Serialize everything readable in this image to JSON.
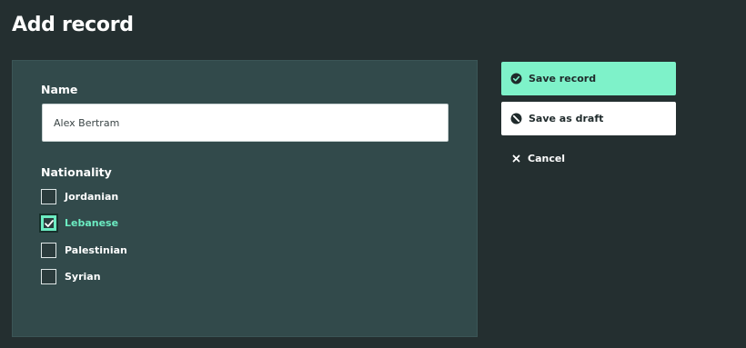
{
  "page": {
    "title": "Add record"
  },
  "form": {
    "name_label": "Name",
    "name_value": "Alex Bertram",
    "nationality_label": "Nationality",
    "nationalities": [
      {
        "label": "Jordanian",
        "checked": false
      },
      {
        "label": "Lebanese",
        "checked": true
      },
      {
        "label": "Palestinian",
        "checked": false
      },
      {
        "label": "Syrian",
        "checked": false
      }
    ]
  },
  "actions": {
    "save_label": "Save record",
    "save_icon": "check-circle-icon",
    "draft_label": "Save as draft",
    "draft_icon": "no-entry-icon",
    "cancel_label": "Cancel",
    "cancel_icon": "close-icon"
  },
  "colors": {
    "background": "#242f30",
    "panel": "#324a4b",
    "accent": "#7ef2c9"
  }
}
